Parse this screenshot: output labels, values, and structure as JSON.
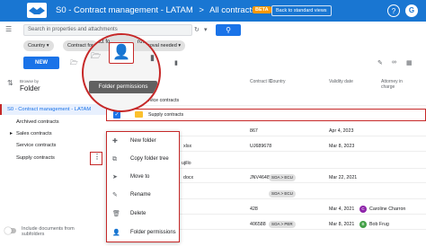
{
  "app": {
    "title": "S0 - Contract management - LATAM",
    "separator": ">",
    "current": "All contracts",
    "beta_label": "BETA",
    "back_label": "Back to standard views",
    "help_icon": "help-icon",
    "avatar_letter": "G",
    "brand_color": "#1976d2"
  },
  "search": {
    "placeholder": "Search in properties and attachments"
  },
  "filters": {
    "country": "Country",
    "contract_for": "Contract for",
    "approval": "roval needed"
  },
  "toolbar": {
    "new_label": "NEW"
  },
  "magnifier": {
    "chip_left": "Contract fo",
    "chip_right": "roval n",
    "tooltip": "Folder permissions"
  },
  "sidebar": {
    "browse_by_label": "Browse by",
    "browse_by_value": "Folder",
    "root": "S0 - Contract management - LATAM",
    "items": [
      {
        "label": "Archived contracts"
      },
      {
        "label": "Sales contracts",
        "bullet": "▸"
      },
      {
        "label": "Service contracts"
      },
      {
        "label": "Supply contracts"
      }
    ],
    "include_label": "Include documents from",
    "include_label2": "subfolders"
  },
  "table": {
    "headers": {
      "contract_id": "Contract ID",
      "country": "Country",
      "validity": "Validity date",
      "attorney": "Attorney in",
      "attorney2": "charge"
    },
    "rows": [
      {
        "name": "ervice contracts",
        "id": "",
        "country": "",
        "date": "",
        "attorney": ""
      },
      {
        "name": "Supply contracts",
        "id": "",
        "country": "",
        "date": "",
        "attorney": ""
      },
      {
        "name": "",
        "id": "867",
        "country": "",
        "date": "Apr 4, 2023",
        "attorney": ""
      },
      {
        "name": "xlsx",
        "id": "UJ689678",
        "country": "",
        "date": "Mar 8, 2023",
        "attorney": ""
      },
      {
        "name": "ujillo",
        "id": "",
        "country": "",
        "date": "",
        "attorney": ""
      },
      {
        "name": "docx",
        "id": "JNV46483",
        "country": "SOA > ECU",
        "date": "Mar 22, 2021",
        "attorney": ""
      },
      {
        "name": "",
        "id": "",
        "country": "SOA > ECU",
        "date": "",
        "attorney": ""
      },
      {
        "name": "",
        "id": "406588",
        "country": "SOA > PER",
        "date": "Mar 8, 2021",
        "attorney": "Bob Frug"
      }
    ],
    "row_caroline": {
      "id": "428",
      "date": "Mar 4, 2021",
      "attorney": "Caroline Charron"
    }
  },
  "menu": {
    "items": [
      {
        "label": "New folder",
        "icon": "new-folder-icon"
      },
      {
        "label": "Copy folder tree",
        "icon": "copy-tree-icon"
      },
      {
        "label": "Move to",
        "icon": "move-to-icon"
      },
      {
        "label": "Rename",
        "icon": "rename-icon"
      },
      {
        "label": "Delete",
        "icon": "delete-icon"
      },
      {
        "label": "Folder permissions",
        "icon": "folder-permissions-icon"
      }
    ]
  }
}
